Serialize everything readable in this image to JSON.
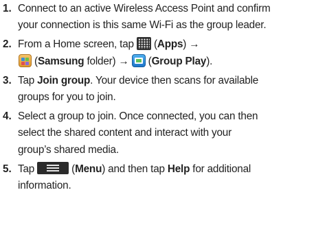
{
  "steps": [
    {
      "number": "1.",
      "line1": "Connect to an active Wireless Access Point and confirm",
      "line2": "your connection is this same Wi-Fi as the group leader."
    },
    {
      "number": "2.",
      "line1_prefix": "From a Home screen, tap ",
      "apps_open": " (",
      "apps_label": "Apps",
      "apps_close": ") →",
      "samsung_open": " (",
      "samsung_label": "Samsung",
      "samsung_mid": " folder) → ",
      "groupplay_open": " (",
      "groupplay_label": "Group Play",
      "groupplay_close": ").",
      "icons": [
        "apps-grid-icon",
        "samsung-folder-icon",
        "group-play-icon"
      ]
    },
    {
      "number": "3.",
      "prefix": "Tap ",
      "bold": "Join group",
      "suffix": ". Your device then scans for available",
      "line2": "groups for you to join."
    },
    {
      "number": "4.",
      "line1": "Select a group to join. Once connected, you can then",
      "line2": "select the shared content and interact with your",
      "line3": "group’s shared media."
    },
    {
      "number": "5.",
      "prefix": "Tap ",
      "menu_open": " (",
      "menu_label": "Menu",
      "menu_mid": ") and then tap ",
      "help_label": "Help",
      "help_suffix": " for additional",
      "line2": "information.",
      "icons": [
        "menu-key-icon"
      ]
    }
  ]
}
